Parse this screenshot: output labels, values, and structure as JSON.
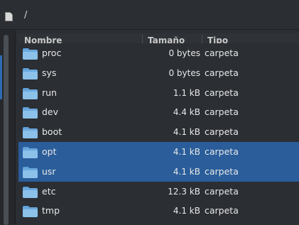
{
  "path_bar": {
    "path": "/",
    "icon": "document-icon"
  },
  "columns": {
    "name": "Nombre",
    "size": "Tamaño",
    "type": "Tipo"
  },
  "rows": [
    {
      "name": "proc",
      "size": "0 bytes",
      "type": "carpeta",
      "selected": false
    },
    {
      "name": "sys",
      "size": "0 bytes",
      "type": "carpeta",
      "selected": false
    },
    {
      "name": "run",
      "size": "1.1 kB",
      "type": "carpeta",
      "selected": false
    },
    {
      "name": "dev",
      "size": "4.4 kB",
      "type": "carpeta",
      "selected": false
    },
    {
      "name": "boot",
      "size": "4.1 kB",
      "type": "carpeta",
      "selected": false
    },
    {
      "name": "opt",
      "size": "4.1 kB",
      "type": "carpeta",
      "selected": true
    },
    {
      "name": "usr",
      "size": "4.1 kB",
      "type": "carpeta",
      "selected": true
    },
    {
      "name": "etc",
      "size": "12.3 kB",
      "type": "carpeta",
      "selected": false
    },
    {
      "name": "tmp",
      "size": "4.1 kB",
      "type": "carpeta",
      "selected": false
    }
  ],
  "colors": {
    "background": "#2b2e33",
    "selection": "#2a5d9a",
    "folder": "#6aa8dd"
  }
}
